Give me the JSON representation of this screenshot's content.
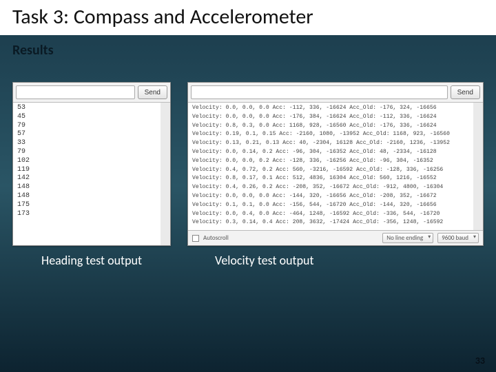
{
  "title": "Task 3: Compass and Accelerometer",
  "subtitle": "Results",
  "leftPanel": {
    "sendLabel": "Send",
    "lines": [
      "53",
      "45",
      "79",
      "57",
      "33",
      "79",
      "102",
      "119",
      "142",
      "148",
      "148",
      "175",
      "173"
    ]
  },
  "rightPanel": {
    "sendLabel": "Send",
    "lines": [
      "Velocity: 0.0, 0.0, 0.0 Acc: -112, 336, -16624 Acc_Old: -176, 324, -16656",
      "Velocity: 0.0, 0.0, 0.0 Acc: -176, 384, -16624 Acc_Old: -112, 336, -16624",
      "Velocity: 0.8, 0.3, 0.0 Acc: 1168, 928, -16560 Acc_Old: -176, 336, -16624",
      "Velocity: 0.19, 0.1, 0.15 Acc: -2160, 1080, -13952 Acc_Old: 1168, 923, -16560",
      "Velocity: 0.13, 0.21, 0.13 Acc: 40, -2304, 16128 Acc_Old: -2160, 1236, -13952",
      "Velocity: 0.0, 0.14, 0.2 Acc: -96, 304, -16352 Acc_Old: 48, -2334, -16128",
      "Velocity: 0.0, 0.0, 0.2 Acc: -128, 336, -16256 Acc_Old: -96, 304, -16352",
      "Velocity: 0.4, 0.72, 0.2 Acc: 560, -3216, -16592 Acc_Old: -128, 336, -16256",
      "Velocity: 0.8, 0.17, 0.1 Acc: 512, 4836, 16304 Acc_Old: 560, 1216, -16552",
      "Velocity: 0.4, 0.26, 0.2 Acc: -208, 352, -16672 Acc_Old: -912, 4800, -16304",
      "Velocity: 0.0, 0.0, 0.0 Acc: -144, 320, -16656 Acc_Old: -208, 352, -16672",
      "Velocity: 0.1, 0.1, 0.0 Acc: -156, 544, -16720 Acc_Old: -144, 320, -16656",
      "Velocity: 0.0, 0.4, 0.0 Acc: -464, 1248, -16592 Acc_Old: -336, 544, -16720",
      "Velocity: 0.3, 0.14, 0.4 Acc: 208, 3632, -17424 Acc_Old: -356, 1248, -16592"
    ],
    "autoscroll": "Autoscroll",
    "lineEnding": "No line ending",
    "baud": "9600 baud"
  },
  "captions": {
    "left": "Heading test output",
    "right": "Velocity test output"
  },
  "pageNumber": "33"
}
